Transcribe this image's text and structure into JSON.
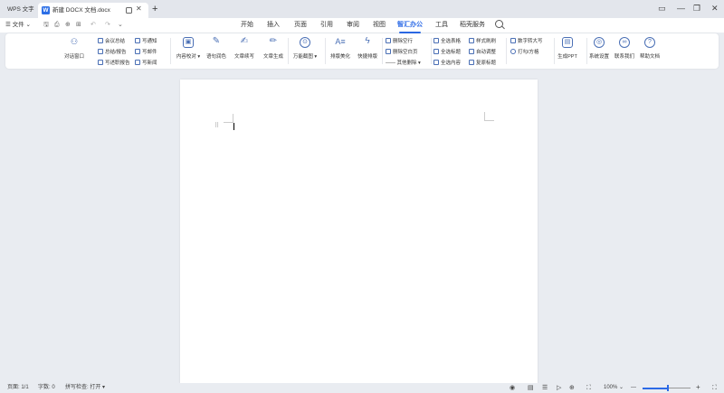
{
  "titlebar": {
    "app_tab": "WPS 文字",
    "doc_title": "新建 DOCX 文档.docx",
    "new_tab": "+",
    "controls": {
      "restore": "▭",
      "minimize": "—",
      "maximize": "❐",
      "close": "✕"
    }
  },
  "menubar": {
    "file_label": "☰ 文件 ⌄",
    "quick_access": [
      "🖫",
      "⎙",
      "⊕",
      "⊞",
      "↶",
      "↷",
      "⌄"
    ],
    "tabs": [
      "开始",
      "插入",
      "页面",
      "引用",
      "审阅",
      "视图",
      "智汇办公",
      "工具",
      "稻壳服务"
    ],
    "active_tab": "智汇办公"
  },
  "ribbon": {
    "dialog_window": "对话窗口",
    "g1": [
      "会议总结",
      "总结/报告",
      "写述职报告"
    ],
    "g2": [
      "写通知",
      "写邮件",
      "写新闻"
    ],
    "big_tools": [
      "内容校对 ▾",
      "语句润色",
      "文章续写",
      "文章生成"
    ],
    "universal": "万能截图 ▾",
    "typeset": "排版美化",
    "fast_typeset": "快捷排版",
    "g3": [
      "删除空行",
      "删除空白页",
      "—— 其他删除 ▾"
    ],
    "g4": [
      "全选表格",
      "全选标题",
      "全选内容"
    ],
    "g5": [
      "样式刷刷",
      "自动调整",
      "复原标题"
    ],
    "g6": [
      "数字转大写",
      "打勾/方格"
    ],
    "gen_ppt": "生成PPT",
    "settings": "系统设置",
    "contact": "联系我们",
    "help": "帮助文档"
  },
  "document": {
    "drag_handle": "⠿"
  },
  "statusbar": {
    "page": "页面: 1/1",
    "words": "字数: 0",
    "spell": "拼写检查: 打开 ▾",
    "zoom": "100% ⌄",
    "zoom_minus": "—",
    "zoom_plus": "+",
    "expand": "⛶",
    "zoom_level": 0.53
  }
}
